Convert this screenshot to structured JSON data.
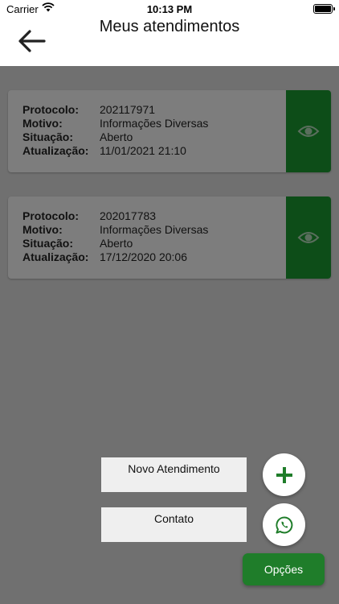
{
  "status_bar": {
    "carrier": "Carrier",
    "time": "10:13 PM"
  },
  "header": {
    "title": "Meus atendimentos",
    "back_icon": "arrow-left-icon"
  },
  "labels": {
    "protocolo": "Protocolo:",
    "motivo": "Motivo:",
    "situacao": "Situação:",
    "atualizacao": "Atualização:"
  },
  "tickets": [
    {
      "protocolo": "202117971",
      "motivo": "Informações Diversas",
      "situacao": "Aberto",
      "atualizacao": "11/01/2021 21:10"
    },
    {
      "protocolo": "202017783",
      "motivo": "Informações Diversas",
      "situacao": "Aberto",
      "atualizacao": "17/12/2020 20:06"
    }
  ],
  "fab_menu": {
    "new_label": "Novo Atendimento",
    "contact_label": "Contato",
    "options_label": "Opções",
    "new_icon": "plus-icon",
    "contact_icon": "whatsapp-icon"
  },
  "colors": {
    "accent": "#1f7d2a",
    "view_button": "#0d4d18",
    "overlay": "#707070"
  }
}
